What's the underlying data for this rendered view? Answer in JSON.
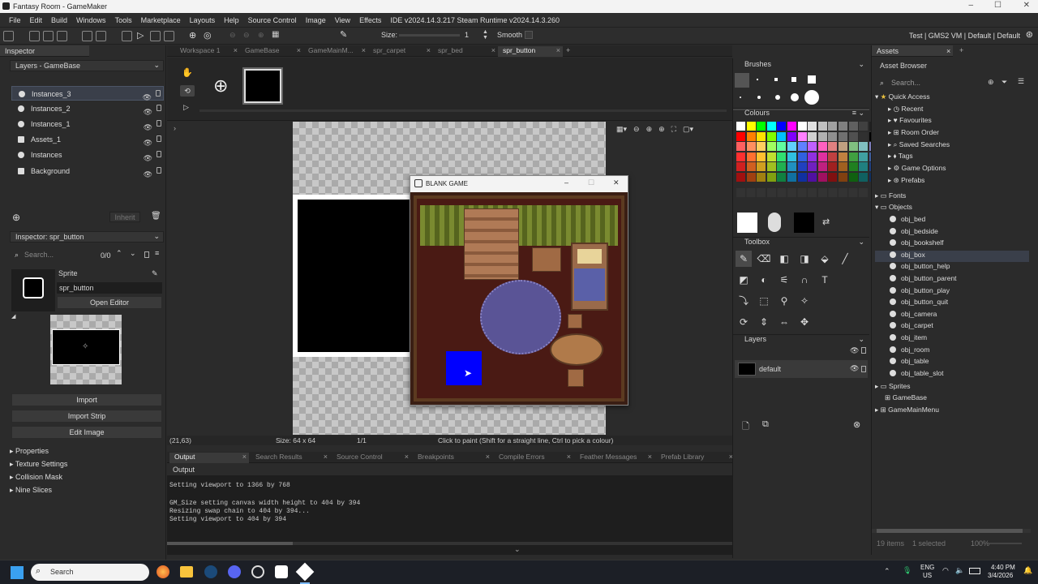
{
  "window": {
    "title": "Fantasy Room - GameMaker",
    "minimize": "–",
    "maximize": "☐",
    "close": "✕"
  },
  "menu": [
    "File",
    "Edit",
    "Build",
    "Windows",
    "Tools",
    "Marketplace",
    "Layouts",
    "Help",
    "Source Control",
    "Image",
    "View",
    "Effects"
  ],
  "ide_version": "IDE v2024.14.3.217 Steam Runtime v2024.14.3.260",
  "target_bar": "Test | GMS2 VM | Default | Default",
  "toolbar": {
    "size_label": "Size:",
    "size_value": "1",
    "smooth_label": "Smooth"
  },
  "inspector": {
    "tab": "Inspector",
    "layers_header": "Layers - GameBase",
    "layers": [
      "Instances_3",
      "Instances_2",
      "Instances_1",
      "Assets_1",
      "Instances",
      "Background"
    ],
    "inherit": "Inherit",
    "inspector_select": "Inspector: spr_button",
    "search_placeholder": "Search...",
    "page": "0/0",
    "sprite_label": "Sprite",
    "sprite_name": "spr_button",
    "open_editor": "Open Editor",
    "import": "Import",
    "import_strip": "Import Strip",
    "edit_image": "Edit Image",
    "props": [
      "Properties",
      "Texture Settings",
      "Collision Mask",
      "Nine Slices"
    ]
  },
  "editor_tabs": [
    "Workspace 1",
    "GameBase",
    "GameMainM...",
    "spr_carpet",
    "spr_bed",
    "spr_button"
  ],
  "status": {
    "coords": "(21,63)",
    "size": "Size: 64 x 64",
    "frames": "1/1",
    "hint": "Click to paint (Shift for a straight line, Ctrl to pick a colour)"
  },
  "game_window": {
    "title": "BLANK GAME"
  },
  "output_tabs": [
    "Output",
    "Search Results",
    "Source Control",
    "Breakpoints",
    "Compile Errors",
    "Feather Messages",
    "Prefab Library"
  ],
  "output": {
    "header": "Output",
    "lines": [
      "Setting viewport to 1366 by 768",
      "",
      "GM_Size setting canvas width height to 404 by 394",
      "Resizing swap chain to 404 by 394...",
      "Setting viewport to 404 by 394"
    ]
  },
  "right": {
    "brushes": "Brushes",
    "colours": "Colours",
    "toolbox": "Toolbox",
    "layers": "Layers",
    "layer_name": "default"
  },
  "palette": [
    "#ffffff",
    "#ffff00",
    "#00ff00",
    "#00ffff",
    "#0000ff",
    "#ff00ff",
    "#ffffff",
    "#e0e0e0",
    "#c0c0c0",
    "#a0a0a0",
    "#808080",
    "#606060",
    "#404040",
    "#202020",
    "#ff0000",
    "#ff8000",
    "#ffe000",
    "#80ff00",
    "#00c0ff",
    "#8000ff",
    "#ff80ff",
    "#d0d0d0",
    "#b0b0b0",
    "#909090",
    "#707070",
    "#505050",
    "#303030",
    "#000000",
    "#ff6060",
    "#ff9060",
    "#ffd060",
    "#a0ff60",
    "#60ffa0",
    "#60d0ff",
    "#6080ff",
    "#c060ff",
    "#ff60c0",
    "#e08080",
    "#c0a080",
    "#80c080",
    "#80c0c0",
    "#8080c0",
    "#ff3030",
    "#ff7030",
    "#ffc030",
    "#c0e030",
    "#30e070",
    "#30c0e0",
    "#3060e0",
    "#9030e0",
    "#e030a0",
    "#c04040",
    "#c08040",
    "#40a040",
    "#40a0a0",
    "#4060a0",
    "#d02020",
    "#d06020",
    "#d0a020",
    "#a0c020",
    "#20b050",
    "#2090c0",
    "#2040c0",
    "#7020c0",
    "#c02080",
    "#a02020",
    "#a06020",
    "#208020",
    "#208080",
    "#204080",
    "#a01010",
    "#a04010",
    "#a08010",
    "#80a010",
    "#108040",
    "#1070a0",
    "#1030a0",
    "#5010a0",
    "#a01060",
    "#801010",
    "#804010",
    "#106010",
    "#106060",
    "#103060"
  ],
  "assets": {
    "tab": "Assets",
    "header": "Asset Browser",
    "search": "Search...",
    "quick": [
      "Quick Access",
      "Recent",
      "Favourites",
      "Room Order",
      "Saved Searches",
      "Tags",
      "Game Options",
      "Prefabs"
    ],
    "folders": [
      "Fonts",
      "Objects"
    ],
    "objects": [
      "obj_bed",
      "obj_bedside",
      "obj_bookshelf",
      "obj_box",
      "obj_button_help",
      "obj_button_parent",
      "obj_button_play",
      "obj_button_quit",
      "obj_camera",
      "obj_carpet",
      "obj_item",
      "obj_room",
      "obj_table",
      "obj_table_slot"
    ],
    "after": [
      "Sprites",
      "GameBase",
      "GameMainMenu"
    ],
    "footer_items": "19 items",
    "footer_sel": "1 selected",
    "zoom": "100%"
  },
  "taskbar": {
    "search": "Search",
    "lang": "ENG",
    "region": "US",
    "time": "4:40 PM",
    "date": "3/4/2026"
  }
}
